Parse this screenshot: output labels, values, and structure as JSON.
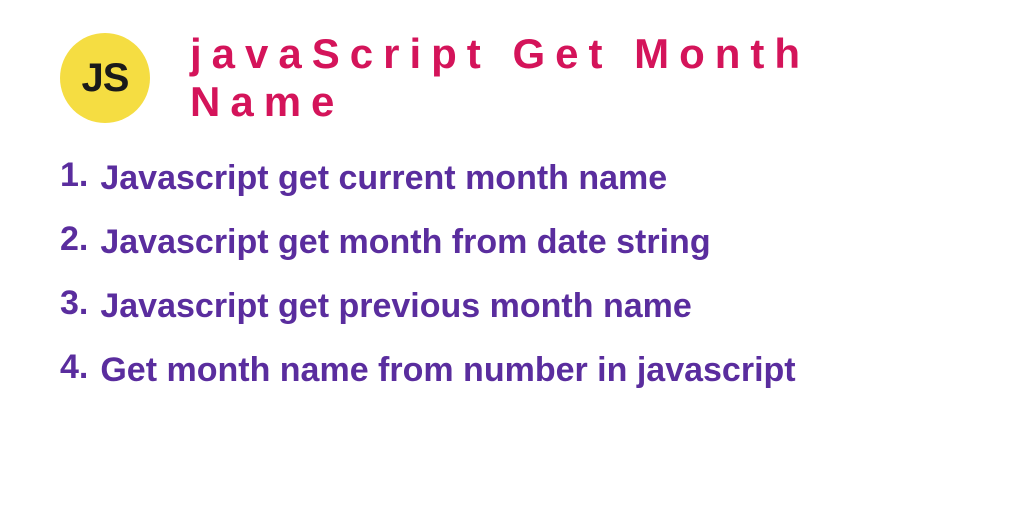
{
  "badge": {
    "text": "JS"
  },
  "title": "javaScript Get Month Name",
  "items": [
    {
      "number": "1.",
      "text": "Javascript get current month name"
    },
    {
      "number": "2.",
      "text": "Javascript get month from date string"
    },
    {
      "number": "3.",
      "text": "Javascript get previous month name"
    },
    {
      "number": "4.",
      "text": "Get month name from number in javascript"
    }
  ]
}
